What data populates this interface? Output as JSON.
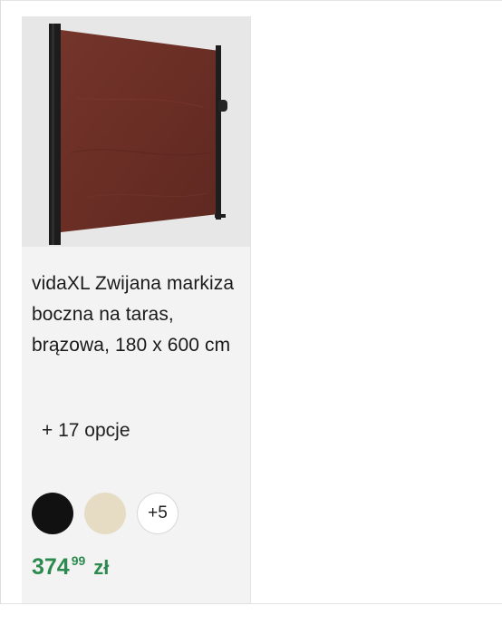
{
  "product": {
    "image_alt": "vidaXL Zwijana markiza boczna na taras, brązowa, 180 x 600 cm",
    "image_colors": {
      "background": "#e7e7e7",
      "fabric": "#6b2f26",
      "frame": "#1c1c1c"
    },
    "title": "vidaXL Zwijana markiza boczna na taras, brązowa, 180 x 600 cm",
    "options_text": "+ 17 opcje",
    "swatches": [
      {
        "name": "black",
        "color": "#111111"
      },
      {
        "name": "beige",
        "color": "#e6dcc4"
      }
    ],
    "more_swatches_label": "+5",
    "price": {
      "integer": "374",
      "decimal": "99",
      "currency": "zł",
      "color": "#2d8a4e"
    }
  }
}
